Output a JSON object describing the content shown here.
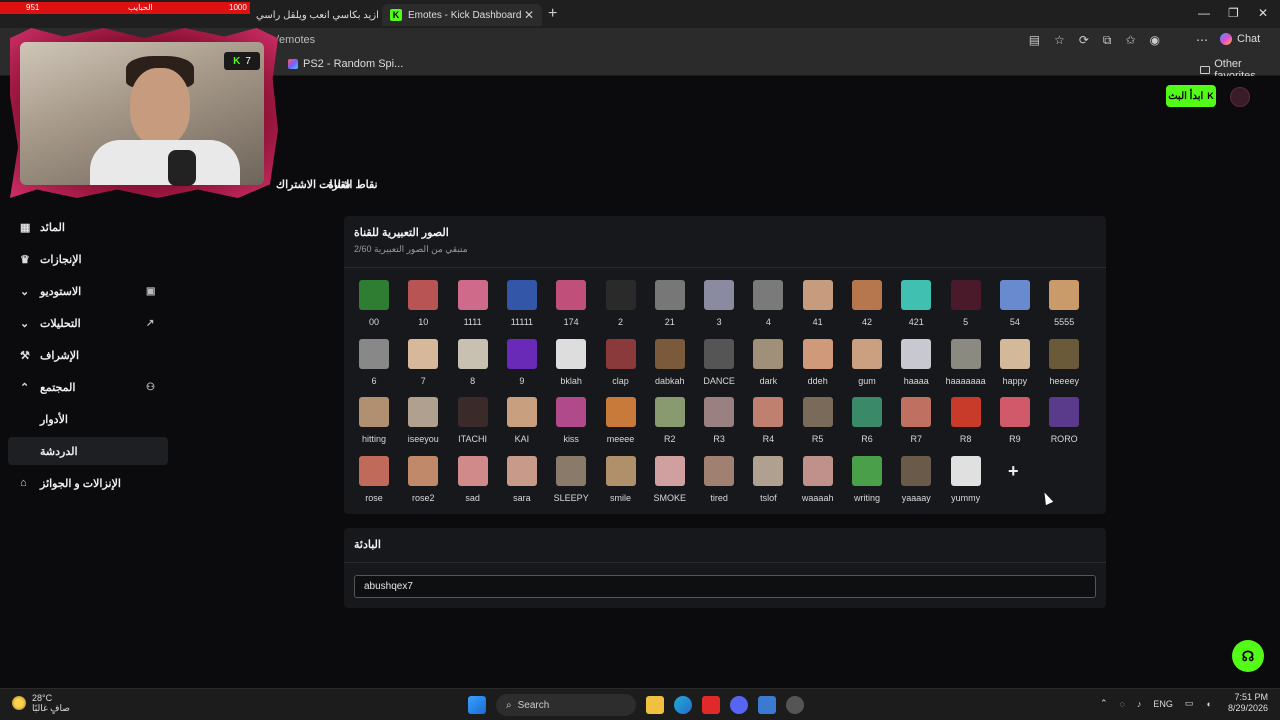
{
  "browser": {
    "tabs": [
      {
        "label": "اشرب ازيد بكاسي انعب ويلقل راسي"
      },
      {
        "label": "Emotes - Kick Dashboard"
      }
    ],
    "url": "/emotes",
    "bookmark": "PS2 - Random Spi...",
    "other_favorites": "Other favorites",
    "chat_label": "Chat"
  },
  "stream_overlay": {
    "left_count": "951",
    "center_label": "الحبايب",
    "right_count": "1000",
    "viewers": "7"
  },
  "header": {
    "start_button": "ابدأ البث"
  },
  "subtabs": [
    {
      "label": "نقاط القناة"
    },
    {
      "label": "شارات الاشتراك"
    }
  ],
  "sidebar": {
    "items": [
      {
        "label": "المائد",
        "icon": "chart-icon"
      },
      {
        "label": "الإنجازات",
        "icon": "trophy-icon"
      },
      {
        "label": "الاستوديو",
        "icon": "chevron-down-icon"
      },
      {
        "label": "التحليلات",
        "icon": "chevron-down-icon"
      },
      {
        "label": "الإشراف",
        "icon": "wrench-icon"
      },
      {
        "label": "المجتمع",
        "icon": "chevron-up-icon"
      },
      {
        "label": "الأدوار",
        "icon": ""
      },
      {
        "label": "الدردشة",
        "icon": ""
      },
      {
        "label": "الإنزالات و الجوائز",
        "icon": "gift-icon"
      }
    ]
  },
  "emotes_card": {
    "title": "الصور التعبيرية للقناة",
    "count": "2/60",
    "subtitle": "متبقي من الصور التعبيرية",
    "emotes": [
      {
        "name": "00",
        "color": "#2e7d32"
      },
      {
        "name": "10",
        "color": "#b85454"
      },
      {
        "name": "1111",
        "color": "#d06a8a"
      },
      {
        "name": "11111",
        "color": "#3456a8"
      },
      {
        "name": "174",
        "color": "#c0507a"
      },
      {
        "name": "2",
        "color": "#2a2a2a"
      },
      {
        "name": "21",
        "color": "#777777"
      },
      {
        "name": "3",
        "color": "#8a8aa0"
      },
      {
        "name": "4",
        "color": "#7a7a7a"
      },
      {
        "name": "41",
        "color": "#c79b7e"
      },
      {
        "name": "42",
        "color": "#b6764e"
      },
      {
        "name": "421",
        "color": "#3fc0b0"
      },
      {
        "name": "5",
        "color": "#4a1a2a"
      },
      {
        "name": "54",
        "color": "#6a8ad0"
      },
      {
        "name": "5555",
        "color": "#c99a6a"
      },
      {
        "name": "6",
        "color": "#888888"
      },
      {
        "name": "7",
        "color": "#d8b89a"
      },
      {
        "name": "8",
        "color": "#c8c0b0"
      },
      {
        "name": "9",
        "color": "#6a2ab8"
      },
      {
        "name": "bklah",
        "color": "#dddddd"
      },
      {
        "name": "clap",
        "color": "#8a3a3a"
      },
      {
        "name": "dabkah",
        "color": "#7a5a3a"
      },
      {
        "name": "DANCE",
        "color": "#555555"
      },
      {
        "name": "dark",
        "color": "#a0907a"
      },
      {
        "name": "ddeh",
        "color": "#d09a7a"
      },
      {
        "name": "gum",
        "color": "#caa080"
      },
      {
        "name": "haaaa",
        "color": "#c8c8d0"
      },
      {
        "name": "haaaaaaa",
        "color": "#8a8a80"
      },
      {
        "name": "happy",
        "color": "#d4b89a"
      },
      {
        "name": "heeeey",
        "color": "#6a5a3a"
      },
      {
        "name": "hitting",
        "color": "#b09070"
      },
      {
        "name": "iseeyou",
        "color": "#b0a090"
      },
      {
        "name": "ITACHI",
        "color": "#3a2a2a"
      },
      {
        "name": "KAI",
        "color": "#c8a080"
      },
      {
        "name": "kiss",
        "color": "#b04a8a"
      },
      {
        "name": "meeee",
        "color": "#c87a3a"
      },
      {
        "name": "R2",
        "color": "#8a9a70"
      },
      {
        "name": "R3",
        "color": "#9a8080"
      },
      {
        "name": "R4",
        "color": "#c08070"
      },
      {
        "name": "R5",
        "color": "#7a6a5a"
      },
      {
        "name": "R6",
        "color": "#3a8a6a"
      },
      {
        "name": "R7",
        "color": "#c07060"
      },
      {
        "name": "R8",
        "color": "#c83a2a"
      },
      {
        "name": "R9",
        "color": "#d05a6a"
      },
      {
        "name": "RORO",
        "color": "#5a3a8a"
      },
      {
        "name": "rose",
        "color": "#c06a5a"
      },
      {
        "name": "rose2",
        "color": "#c08a6a"
      },
      {
        "name": "sad",
        "color": "#d08a8a"
      },
      {
        "name": "sara",
        "color": "#c89a8a"
      },
      {
        "name": "SLEEPY",
        "color": "#8a7a6a"
      },
      {
        "name": "smile",
        "color": "#b0906a"
      },
      {
        "name": "SMOKE",
        "color": "#d0a0a0"
      },
      {
        "name": "tired",
        "color": "#a08070"
      },
      {
        "name": "tslof",
        "color": "#b0a090"
      },
      {
        "name": "waaaah",
        "color": "#c0908a"
      },
      {
        "name": "writing",
        "color": "#4aa04a"
      },
      {
        "name": "yaaaay",
        "color": "#6a5a4a"
      },
      {
        "name": "yummy",
        "color": "#e0e0e0"
      }
    ],
    "add_label": "+"
  },
  "prefix_card": {
    "title": "البادئة",
    "value": "abushqex7"
  },
  "taskbar": {
    "temp": "28°C",
    "weather": "صافٍ غالبًا",
    "search": "Search",
    "lang": "ENG",
    "time": "7:51 PM",
    "date": "8/29/2026"
  }
}
